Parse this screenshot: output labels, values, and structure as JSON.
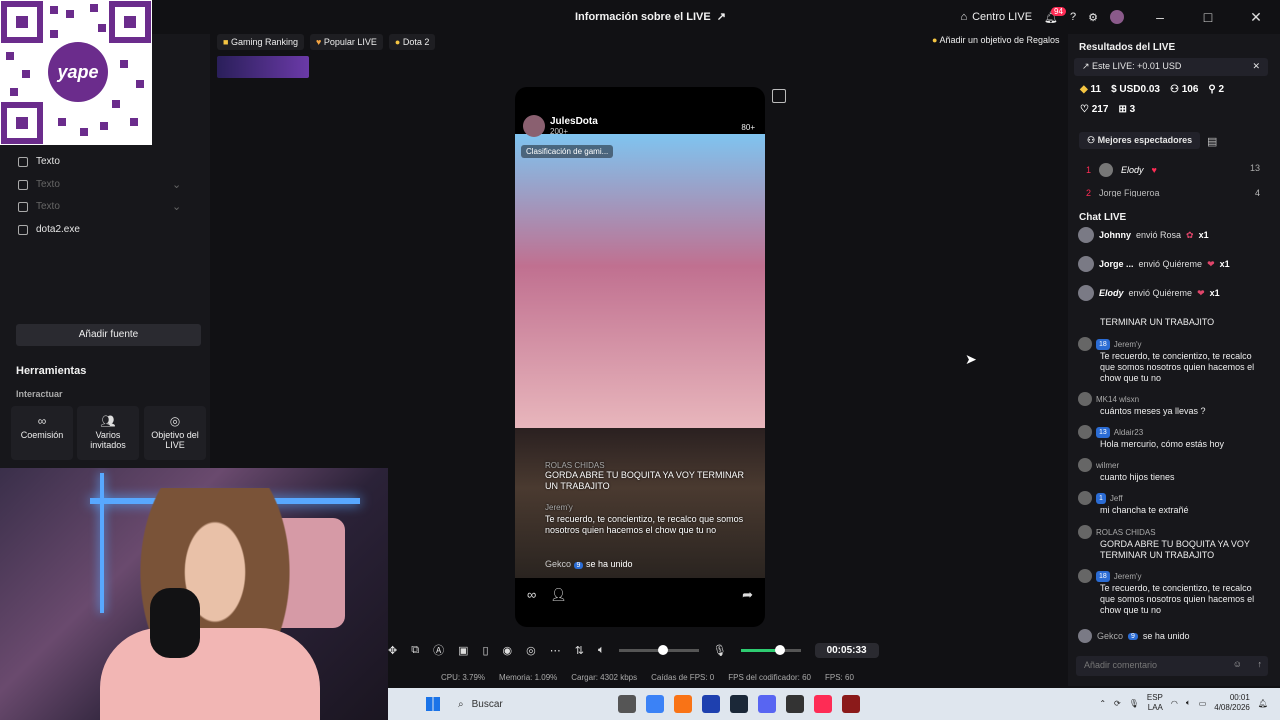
{
  "header": {
    "title": "Información sobre el LIVE",
    "centro_live": "Centro LIVE",
    "notifications_count": "94"
  },
  "left_panel": {
    "sources": [
      "Texto",
      "Texto",
      "Texto",
      "dota2.exe"
    ],
    "add_source": "Añadir fuente",
    "tools_title": "Herramientas",
    "interact_label": "Interactuar",
    "tools": [
      "Coemisión",
      "Varios invitados",
      "Objetivo del LIVE"
    ]
  },
  "center": {
    "tags": [
      "Gaming Ranking",
      "Popular LIVE",
      "Dota 2"
    ],
    "goals": "Añadir un objetivo de Regalos",
    "phone": {
      "username": "JulesDota",
      "followers": "200+",
      "viewers": "80+",
      "chip": "Clasificación de gami...",
      "messages": [
        {
          "user": "ROLAS CHIDAS",
          "text": "GORDA ABRE TU BOQUITA YA VOY TERMINAR UN TRABAJITO"
        },
        {
          "user": "Jerem'y",
          "level": "18",
          "text": "Te recuerdo, te concientizo, te recalco que somos nosotros quien hacemos el chow que tu no"
        }
      ],
      "join_user": "Gekco",
      "join_level": "9",
      "join_text": "se ha unido"
    },
    "timer": "00:05:33",
    "volume_level": 0.5,
    "mic_level": 0.6
  },
  "stats": {
    "cpu": "CPU: 3.79%",
    "memory": "Memoria: 1.09%",
    "upload": "Cargar: 4302 kbps",
    "fps_drops": "Caídas de FPS: 0",
    "encoder_fps": "FPS del codificador: 60",
    "fps": "FPS: 60"
  },
  "right_panel": {
    "results_title": "Resultados del LIVE",
    "this_live": "Este LIVE: +0.01 USD",
    "stat_row1": [
      "11",
      "USD0.03",
      "106",
      "2"
    ],
    "stat_row2": [
      "217",
      "3"
    ],
    "best_viewers": "Mejores espectadores",
    "ranking": [
      {
        "pos": "1",
        "name": "Elody",
        "score": "13"
      },
      {
        "pos": "2",
        "name": "Jorge Figueroa",
        "score": "4"
      }
    ],
    "chat_title": "Chat LIVE",
    "gifts": [
      {
        "user": "Johnny",
        "action": "envió Rosa",
        "count": "x1"
      },
      {
        "user": "Jorge ...",
        "action": "envió Quiéreme",
        "count": "x1"
      },
      {
        "user": "Elody",
        "action": "envió Quiéreme",
        "count": "x1"
      }
    ],
    "chat": [
      {
        "user": "",
        "level": "",
        "text": "TERMINAR UN TRABAJITO"
      },
      {
        "user": "Jerem'y",
        "level": "18",
        "text": "Te recuerdo, te concientizo, te recalco que somos nosotros quien hacemos el chow que tu no"
      },
      {
        "user": "MK14 wlsxn",
        "level": "",
        "text": "cuántos meses ya llevas ?"
      },
      {
        "user": "Aldair23",
        "level": "13",
        "text": "Hola mercurio, cómo estás hoy"
      },
      {
        "user": "wilmer",
        "level": "",
        "text": "cuanto hijos tienes"
      },
      {
        "user": "Jeff",
        "level": "1",
        "text": "mi chancha te extrañé"
      },
      {
        "user": "ROLAS CHIDAS",
        "level": "",
        "text": "GORDA ABRE TU BOQUITA YA VOY TERMINAR UN TRABAJITO"
      },
      {
        "user": "Jerem'y",
        "level": "18",
        "text": "Te recuerdo, te concientizo, te recalco que somos nosotros quien hacemos el chow que tu no"
      }
    ],
    "join_user": "Gekco",
    "join_level": "9",
    "join_text": "se ha unido",
    "comment_placeholder": "Añadir comentario"
  },
  "taskbar": {
    "search": "Buscar",
    "lang1": "ESP",
    "lang2": "LAA",
    "time": "00:01",
    "date": "4/08/2026"
  }
}
